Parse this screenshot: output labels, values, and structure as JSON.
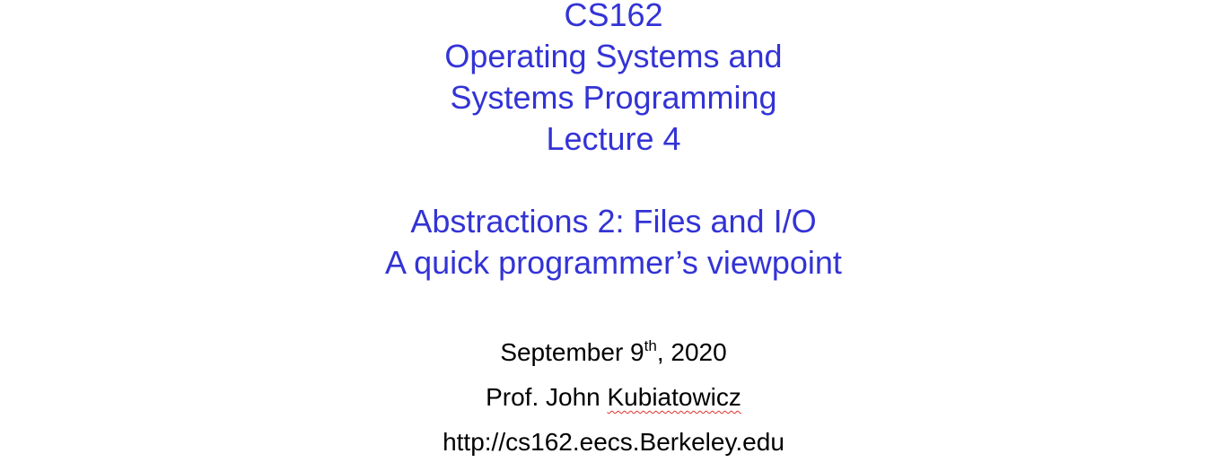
{
  "title": {
    "course": "CS162",
    "line1": "Operating Systems and",
    "line2": "Systems Programming",
    "lecture": "Lecture 4"
  },
  "subtitle": {
    "line1": "Abstractions 2: Files and I/O",
    "line2": "A quick programmer’s viewpoint"
  },
  "date": {
    "prefix": "September 9",
    "ordinal": "th",
    "suffix": ", 2020"
  },
  "author": {
    "prefix": "Prof. John ",
    "surname": "Kubiatowicz"
  },
  "url": "http://cs162.eecs.Berkeley.edu",
  "colors": {
    "title": "#3333d6",
    "body": "#000000",
    "spellcheck_underline": "#e03030"
  }
}
